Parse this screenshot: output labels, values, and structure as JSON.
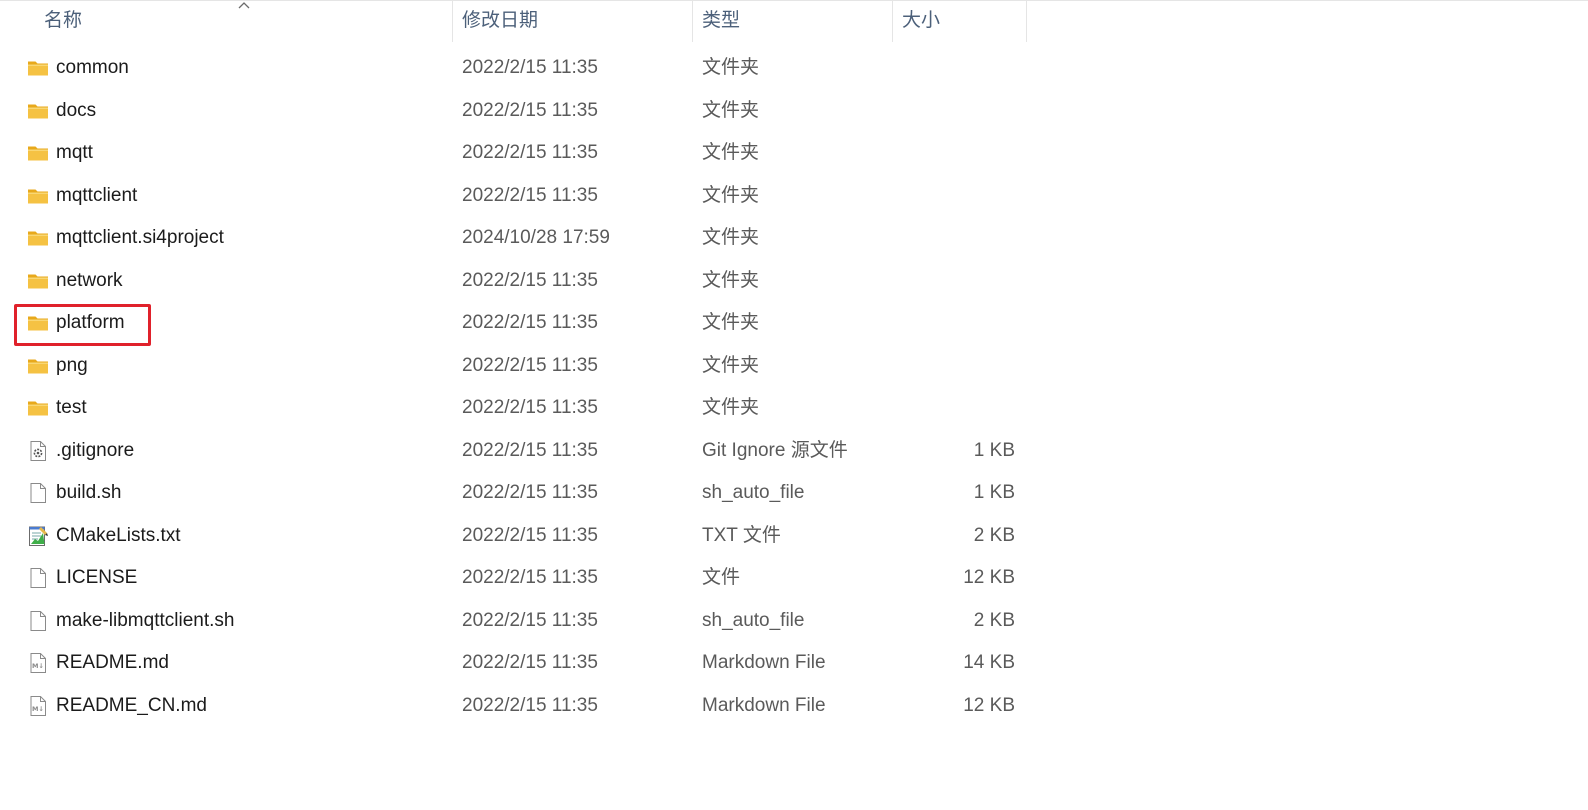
{
  "columns": {
    "name": "名称",
    "date": "修改日期",
    "type": "类型",
    "size": "大小"
  },
  "colors": {
    "header_text": "#4c607a",
    "folder": "#f5c243",
    "highlight": "#e0212b"
  },
  "files": [
    {
      "name": "common",
      "date": "2022/2/15 11:35",
      "type": "文件夹",
      "size": "",
      "icon": "folder-icon"
    },
    {
      "name": "docs",
      "date": "2022/2/15 11:35",
      "type": "文件夹",
      "size": "",
      "icon": "folder-icon"
    },
    {
      "name": "mqtt",
      "date": "2022/2/15 11:35",
      "type": "文件夹",
      "size": "",
      "icon": "folder-icon"
    },
    {
      "name": "mqttclient",
      "date": "2022/2/15 11:35",
      "type": "文件夹",
      "size": "",
      "icon": "folder-icon"
    },
    {
      "name": "mqttclient.si4project",
      "date": "2024/10/28 17:59",
      "type": "文件夹",
      "size": "",
      "icon": "folder-icon"
    },
    {
      "name": "network",
      "date": "2022/2/15 11:35",
      "type": "文件夹",
      "size": "",
      "icon": "folder-icon"
    },
    {
      "name": "platform",
      "date": "2022/2/15 11:35",
      "type": "文件夹",
      "size": "",
      "icon": "folder-icon",
      "highlighted": true
    },
    {
      "name": "png",
      "date": "2022/2/15 11:35",
      "type": "文件夹",
      "size": "",
      "icon": "folder-icon"
    },
    {
      "name": "test",
      "date": "2022/2/15 11:35",
      "type": "文件夹",
      "size": "",
      "icon": "folder-icon"
    },
    {
      "name": ".gitignore",
      "date": "2022/2/15 11:35",
      "type": "Git Ignore 源文件",
      "size": "1 KB",
      "icon": "settings-file-icon"
    },
    {
      "name": "build.sh",
      "date": "2022/2/15 11:35",
      "type": "sh_auto_file",
      "size": "1 KB",
      "icon": "file-icon"
    },
    {
      "name": "CMakeLists.txt",
      "date": "2022/2/15 11:35",
      "type": "TXT 文件",
      "size": "2 KB",
      "icon": "text-file-icon"
    },
    {
      "name": "LICENSE",
      "date": "2022/2/15 11:35",
      "type": "文件",
      "size": "12 KB",
      "icon": "file-icon"
    },
    {
      "name": "make-libmqttclient.sh",
      "date": "2022/2/15 11:35",
      "type": "sh_auto_file",
      "size": "2 KB",
      "icon": "file-icon"
    },
    {
      "name": "README.md",
      "date": "2022/2/15 11:35",
      "type": "Markdown File",
      "size": "14 KB",
      "icon": "markdown-file-icon"
    },
    {
      "name": "README_CN.md",
      "date": "2022/2/15 11:35",
      "type": "Markdown File",
      "size": "12 KB",
      "icon": "markdown-file-icon"
    }
  ]
}
